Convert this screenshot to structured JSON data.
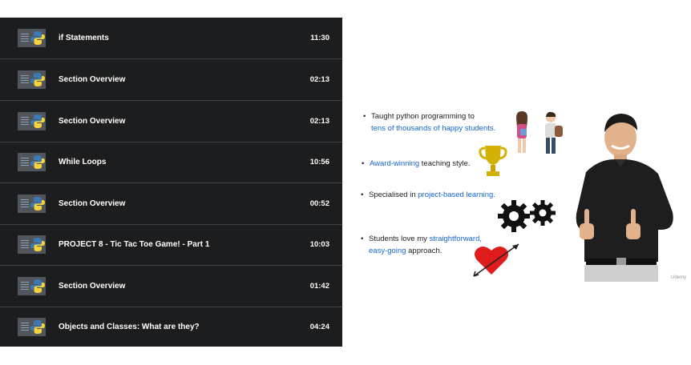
{
  "playlist": {
    "items": [
      {
        "title": "if Statements",
        "duration": "11:30"
      },
      {
        "title": "Section Overview",
        "duration": "02:13"
      },
      {
        "title": "Section Overview",
        "duration": "02:13"
      },
      {
        "title": "While Loops",
        "duration": "10:56"
      },
      {
        "title": "Section Overview",
        "duration": "00:52"
      },
      {
        "title": "PROJECT 8 - Tic Tac Toe Game! - Part 1",
        "duration": "10:03"
      },
      {
        "title": "Section Overview",
        "duration": "01:42"
      },
      {
        "title": "Objects and Classes: What are they?",
        "duration": "04:24"
      }
    ]
  },
  "slide": {
    "bullet1": {
      "line1": "Taught python programming to",
      "line2": "tens of thousands of happy students."
    },
    "bullet2": {
      "hl": "Award-winning",
      "rest": " teaching style."
    },
    "bullet3": {
      "pre": "Specialised in ",
      "hl": "project-based learning."
    },
    "bullet4": {
      "pre": "Students love my ",
      "hl1": "straightforward,",
      "hl2": "easy-going",
      "rest": " approach."
    },
    "watermark": "Udemy"
  },
  "colors": {
    "playlist_bg": "#1c1d1f",
    "highlight": "#1565d8",
    "trophy": "#d4b106",
    "heart": "#e01b1b"
  }
}
